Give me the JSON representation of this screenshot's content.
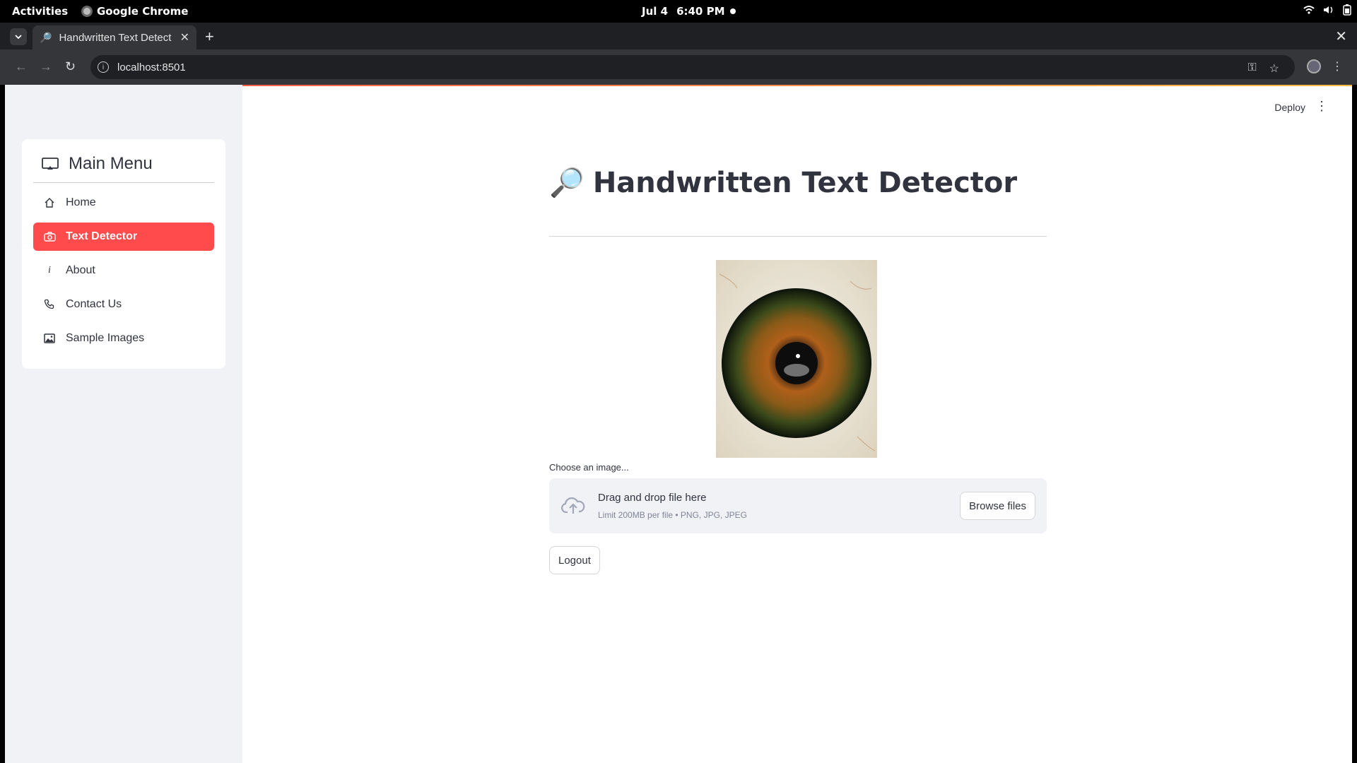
{
  "system": {
    "activities": "Activities",
    "app_name": "Google Chrome",
    "date": "Jul 4",
    "time": "6:40 PM"
  },
  "browser": {
    "tab_title": "Handwritten Text Detect",
    "tab_favicon": "🔎",
    "address": "localhost:8501"
  },
  "app": {
    "deploy_label": "Deploy",
    "title_emoji": "🔎",
    "title": "Handwritten Text Detector",
    "menu": {
      "title": "Main Menu",
      "items": [
        {
          "label": "Home",
          "icon": "house-icon"
        },
        {
          "label": "Text Detector",
          "icon": "camera-icon",
          "active": true
        },
        {
          "label": "About",
          "icon": "info-icon"
        },
        {
          "label": "Contact Us",
          "icon": "phone-icon"
        },
        {
          "label": "Sample Images",
          "icon": "image-icon"
        }
      ]
    },
    "uploader": {
      "label": "Choose an image...",
      "drop_text": "Drag and drop file here",
      "limit_text": "Limit 200MB per file • PNG, JPG, JPEG",
      "browse_label": "Browse files"
    },
    "logout_label": "Logout",
    "colors": {
      "accent": "#ff4b4b",
      "sidebar_bg": "#f0f2f6",
      "text": "#31333f"
    }
  }
}
